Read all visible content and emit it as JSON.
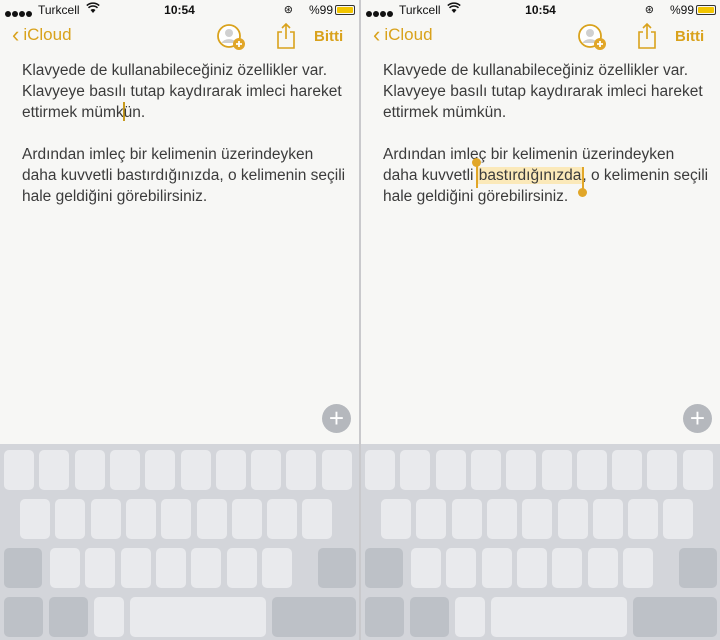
{
  "status": {
    "carrier": "Turkcell",
    "time": "10:54",
    "battery": "%99",
    "battery_level": 0.99
  },
  "nav": {
    "back": "iCloud",
    "done": "Bitti"
  },
  "note": {
    "para1": "Klavyede de kullanabileceğiniz özellikler var. Klavyeye basılı tutap kaydırarak imleci hareket ettirmek mümk",
    "para1_tail": "ün.",
    "para2_before": "Ardından imleç bir kelimenin üzerindeyken daha kuvvetli ",
    "para2_selected": "bastırdığınızda",
    "para2_after": ", o kelimenin seçili hale geldiğini görebilirsiniz.",
    "para1_full": "Klavyede de kullanabileceğiniz özellikler var. Klavyeye basılı tutap kaydırarak imleci hareket ettirmek mümkün."
  },
  "colors": {
    "accent": "#d9a21c",
    "selection": "#fbe9b9",
    "handle": "#e1a628"
  },
  "icons": {
    "back": "chevron-left-icon",
    "collab": "add-person-icon",
    "share": "share-icon",
    "plus": "plus-icon"
  }
}
